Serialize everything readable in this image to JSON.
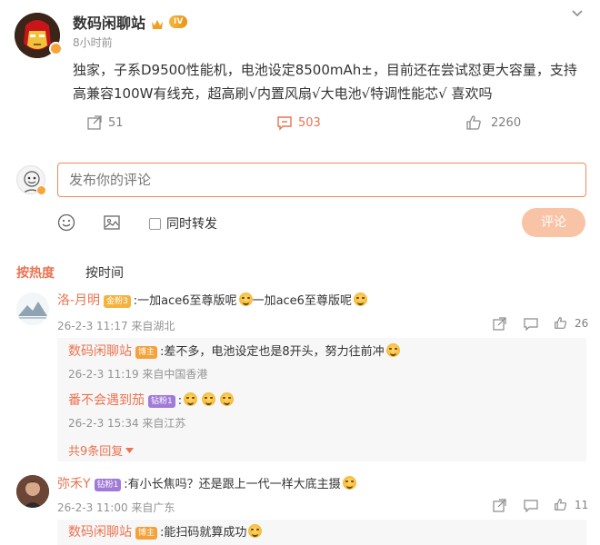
{
  "post": {
    "author": "数码闲聊站",
    "level_badge": "IV",
    "time": "8小时前",
    "content": "独家，子系D9500性能机，电池设定8500mAh±，目前还在尝试怼更大容量，支持高兼容100W有线充，超高刷√内置风扇√大电池√特调性能芯√ 喜欢吗",
    "reposts": "51",
    "comments": "503",
    "likes": "2260"
  },
  "composer": {
    "placeholder": "发布你的评论",
    "repost_label": "同时转发",
    "submit_label": "评论"
  },
  "sort_tabs": {
    "hot": "按热度",
    "time": "按时间"
  },
  "comments": [
    {
      "user": "洛-月明",
      "badge": "金粉3",
      "text": ":一加ace6至尊版呢",
      "text2": "一加ace6至尊版呢",
      "meta": "26-2-3 11:17 来自湖北",
      "likes": "26",
      "replies": [
        {
          "user": "数码闲聊站",
          "badge": "博主",
          "text": ":差不多，电池设定也是8开头，努力往前冲",
          "meta": "26-2-3 11:19 来自中国香港"
        },
        {
          "user": "番不会遇到茄",
          "badge": "钻粉1",
          "text": ":",
          "meta": "26-2-3 15:34 来自江苏"
        }
      ],
      "more_replies": "共9条回复"
    },
    {
      "user": "弥禾Y",
      "badge": "钻粉1",
      "text": ":有小长焦吗？还是跟上一代一样大底主摄",
      "meta": "26-2-3 11:00 来自广东",
      "likes": "11",
      "replies": [
        {
          "user": "数码闲聊站",
          "badge": "博主",
          "text": ":能扫码就算成功"
        }
      ]
    }
  ],
  "colors": {
    "accent": "#eb7350",
    "meta": "#939393",
    "submit_disabled": "#f9c3a6"
  }
}
